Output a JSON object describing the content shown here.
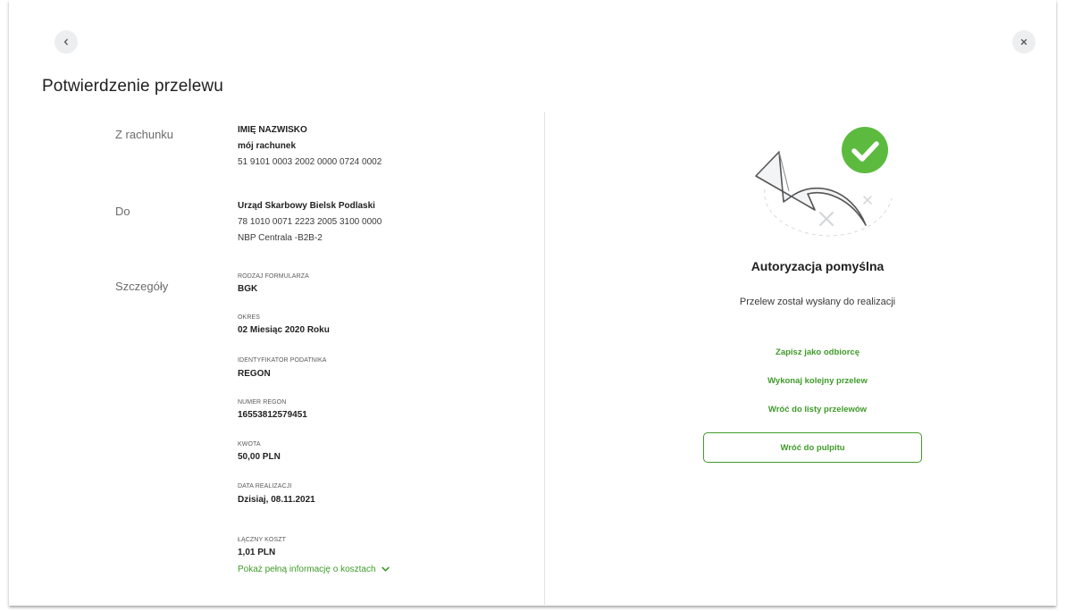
{
  "header": {
    "back_icon": "chevron-left-icon",
    "close_icon": "close-icon",
    "title": "Potwierdzenie przelewu"
  },
  "from_account": {
    "label": "Z rachunku",
    "owner": "IMIĘ NAZWISKO",
    "account_name": "mój rachunek",
    "number": "51 9101 0003 2002 0000 0724 0002"
  },
  "to_account": {
    "label": "Do",
    "name": "Urząd Skarbowy Bielsk Podlaski",
    "number": "78 1010 0071 2223 2005 3100 0000",
    "bank": "NBP Centrala -B2B-2"
  },
  "details": {
    "label": "Szczegóły",
    "items": [
      {
        "caption": "RODZAJ FORMULARZA",
        "value": "BGK"
      },
      {
        "caption": "OKRES",
        "value": "02 Miesiąc 2020 Roku"
      },
      {
        "caption": "IDENTYFIKATOR PODATNIKA",
        "value": "REGON"
      },
      {
        "caption": "NUMER REGON",
        "value": "16553812579451"
      },
      {
        "caption": "KWOTA",
        "value": "50,00 PLN"
      },
      {
        "caption": "DATA REALIZACJI",
        "value": "Dzisiaj, 08.11.2021"
      },
      {
        "caption": "ŁĄCZNY KOSZT",
        "value": "1,01 PLN"
      }
    ],
    "cost_link": "Pokaż pełną informację o kosztach",
    "cost_link_icon": "chevron-down-icon"
  },
  "result": {
    "title": "Autoryzacja pomyślna",
    "subtitle": "Przelew został wysłany do realizacji",
    "links": [
      "Zapisz jako odbiorcę",
      "Wykonaj kolejny przelew",
      "Wróć do listy przelewów"
    ],
    "button": "Wróć do pulpitu",
    "illustration_icon": "success-check-icon"
  },
  "colors": {
    "accent_green": "#3f9b2a",
    "check_green": "#5cbb3f"
  }
}
